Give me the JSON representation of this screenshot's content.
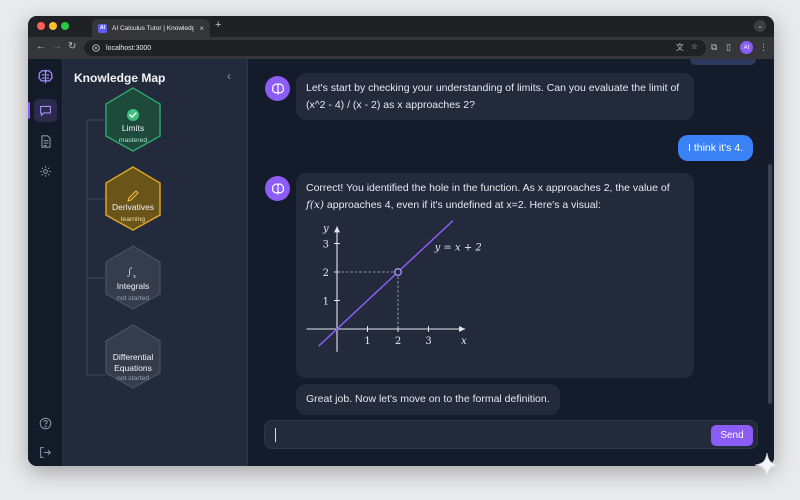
{
  "browser": {
    "tab_title": "AI Calculus Tutor | Knowledge",
    "favicon_text": "AI",
    "url": "localhost:3000",
    "profile_initials": "AI"
  },
  "sidebar": {
    "title": "Knowledge Map",
    "nodes": [
      {
        "name": "Limits",
        "status": "mastered",
        "icon": "check-icon",
        "color": "#2fa36b"
      },
      {
        "name": "Derivatives",
        "status": "learning",
        "icon": "pencil-icon",
        "color": "#d8a52a"
      },
      {
        "name": "Integrals",
        "status": "not started",
        "icon": "integral-icon",
        "color": "#3f4656"
      },
      {
        "name": "Differential Equations",
        "status": "not started",
        "icon": "",
        "color": "#3f4656"
      }
    ]
  },
  "chat": {
    "messages": [
      {
        "role": "tutor",
        "text": "Let's start by checking your understanding of limits. Can you evaluate the limit of (x^2 - 4) / (x - 2) as x approaches 2?"
      },
      {
        "role": "user",
        "text": "I think it's 4."
      },
      {
        "role": "tutor",
        "text_pre": "Correct! You identified the hole in the function. As x approaches 2, the value of ",
        "text_fx": "f(x)",
        "text_post": " approaches 4, even if it's undefined at x=2. Here's a visual:"
      },
      {
        "role": "tutor",
        "text": "Great job. Now let's move on to the formal definition."
      }
    ],
    "send_label": "Send",
    "input_value": ""
  },
  "chart_data": {
    "type": "line",
    "series": [
      {
        "name": "y = x + 2",
        "x": [
          -0.6,
          3.8
        ],
        "y": [
          -0.6,
          3.8
        ]
      }
    ],
    "open_point": {
      "x": 2,
      "y": 2
    },
    "x_ticks": [
      1,
      2,
      3
    ],
    "y_ticks": [
      1,
      2,
      3
    ],
    "xlabel": "x",
    "ylabel": "y",
    "annotation": "y = x + 2",
    "xlim": [
      -1,
      4.2
    ],
    "ylim": [
      -0.8,
      3.6
    ]
  },
  "colors": {
    "accent": "#8b5cf6",
    "user_bubble": "#3b82f6",
    "mastered": "#2fa36b",
    "learning": "#d8a52a"
  }
}
